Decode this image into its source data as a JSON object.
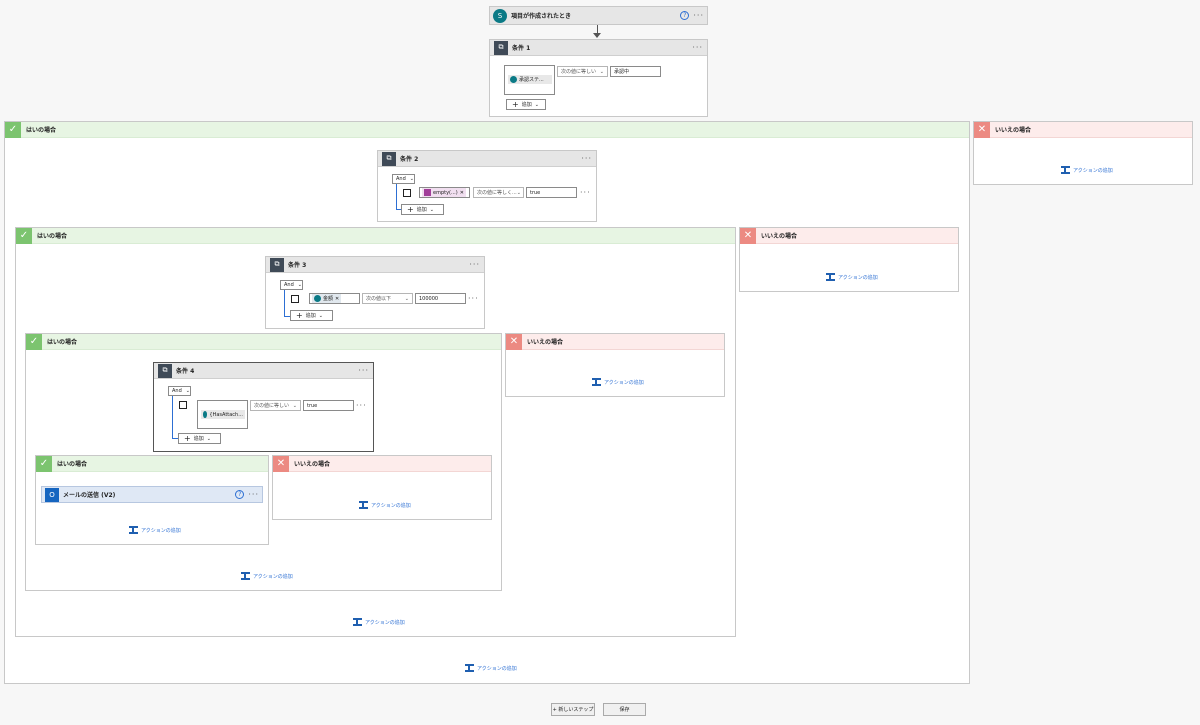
{
  "trigger": {
    "title": "項目が作成されたとき"
  },
  "cond1": {
    "title": "条件 1",
    "token": "承認ステ...",
    "operator": "次の値に等しい",
    "value": "承認中",
    "add_label": "追加"
  },
  "cond2": {
    "title": "条件 2",
    "and_label": "And",
    "token": "empty(...)",
    "operator": "次の値に等しく...",
    "value": "true",
    "add_label": "追加"
  },
  "cond3": {
    "title": "条件 3",
    "and_label": "And",
    "token": "金額",
    "operator": "次の値以下",
    "value": "100000",
    "add_label": "追加"
  },
  "cond4": {
    "title": "条件 4",
    "and_label": "And",
    "token": "{HasAttach...",
    "operator": "次の値に等しい",
    "value": "true",
    "add_label": "追加"
  },
  "send_mail": {
    "title": "メールの送信 (V2)"
  },
  "labels": {
    "yes": "はいの場合",
    "no": "いいえの場合",
    "add_action": "アクションの追加"
  },
  "footer": {
    "new_step": "+ 新しいステップ",
    "save": "保存"
  }
}
